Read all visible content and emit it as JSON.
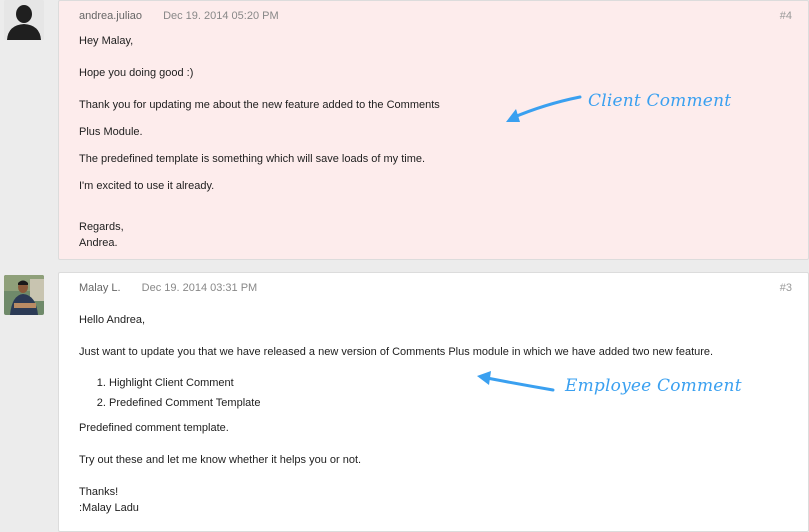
{
  "comments": [
    {
      "author": "andrea.juliao",
      "timestamp": "Dec 19. 2014 05:20 PM",
      "number": "#4",
      "lines": {
        "l1": "Hey Malay,",
        "l2": "Hope you doing good :)",
        "l3": "Thank you for updating me about the new feature added to the Comments",
        "l4": "Plus Module.",
        "l5": "The predefined template is something which will save loads of my time.",
        "l6": "I'm excited to use it already.",
        "l7": "Regards,",
        "l8": "Andrea."
      }
    },
    {
      "author": "Malay L.",
      "timestamp": "Dec 19. 2014 03:31 PM",
      "number": "#3",
      "lines": {
        "l1": "Hello Andrea,",
        "l2": "Just want to update you that we have released a new version of Comments Plus module in which we have added two new feature.",
        "list": [
          "Highlight Client Comment",
          "Predefined Comment Template"
        ],
        "l3": "Predefined comment template.",
        "l4": "Try out these and let me know whether it helps you or not.",
        "l5": "Thanks!",
        "l6": ":Malay Ladu"
      }
    }
  ],
  "annotations": {
    "client": "Client Comment",
    "employee": "Employee Comment"
  },
  "colors": {
    "client_bg": "#fdecec",
    "employee_bg": "#ffffff",
    "annotation": "#3aa0f0"
  }
}
